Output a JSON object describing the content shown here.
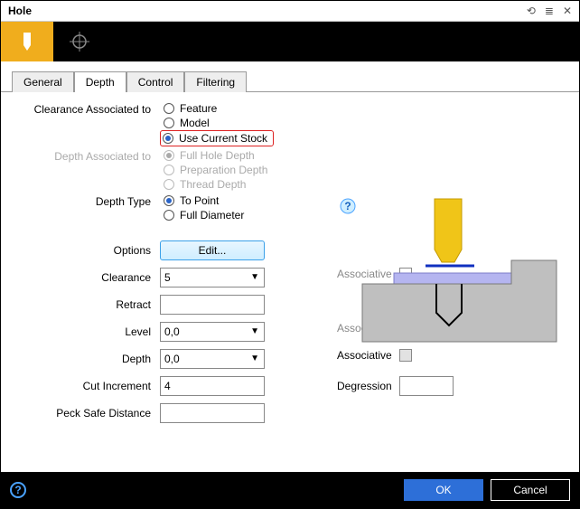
{
  "window": {
    "title": "Hole"
  },
  "tabs": {
    "t0": "General",
    "t1": "Depth",
    "t2": "Control",
    "t3": "Filtering"
  },
  "groups": {
    "clearanceAssoc": {
      "label": "Clearance Associated to",
      "opt0": "Feature",
      "opt1": "Model",
      "opt2": "Use Current Stock"
    },
    "depthAssoc": {
      "label": "Depth Associated to",
      "opt0": "Full Hole Depth",
      "opt1": "Preparation Depth",
      "opt2": "Thread Depth"
    },
    "depthType": {
      "label": "Depth Type",
      "opt0": "To Point",
      "opt1": "Full Diameter"
    }
  },
  "form": {
    "optionsLabel": "Options",
    "editLabel": "Edit...",
    "clearanceLabel": "Clearance",
    "clearanceValue": "5",
    "retractLabel": "Retract",
    "retractValue": "",
    "levelLabel": "Level",
    "levelValue": "0,0",
    "depthLabel": "Depth",
    "depthValue": "0,0",
    "cutIncrLabel": "Cut Increment",
    "cutIncrValue": "4",
    "peckLabel": "Peck Safe Distance",
    "peckValue": "",
    "assocLabel": "Associative",
    "degressionLabel": "Degression",
    "degressionValue": ""
  },
  "footer": {
    "ok": "OK",
    "cancel": "Cancel"
  }
}
